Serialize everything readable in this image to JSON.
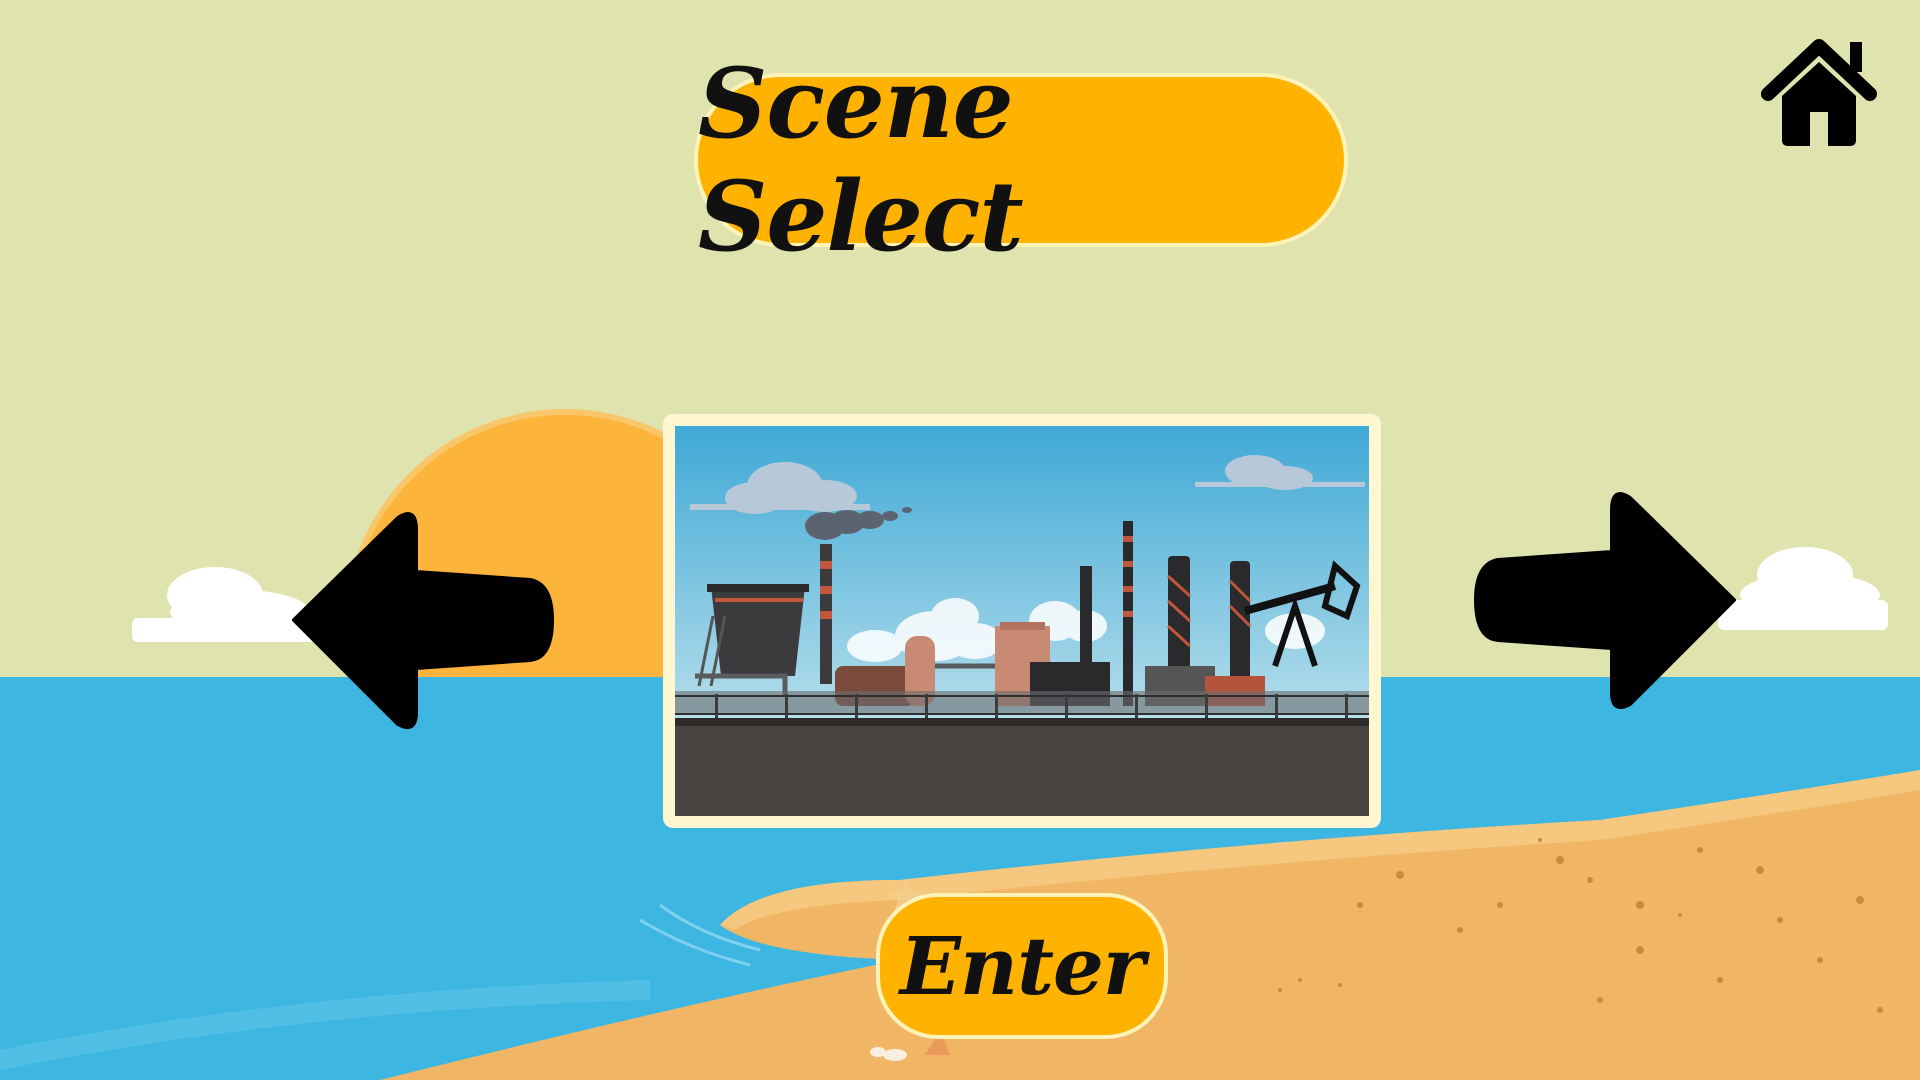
{
  "screen": {
    "title": "Scene Select",
    "enter_label": "Enter"
  },
  "icons": {
    "home": "home-icon",
    "previous": "arrow-left-icon",
    "next": "arrow-right-icon"
  },
  "scene": {
    "preview": "industrial-factory-scene"
  },
  "colors": {
    "sky": "#dfe3ae",
    "sea": "#3db6e2",
    "sand": "#f0b665",
    "sun": "#fdb43b",
    "button": "#ffb300",
    "button_border": "#fff3b8",
    "ink": "#111111"
  }
}
